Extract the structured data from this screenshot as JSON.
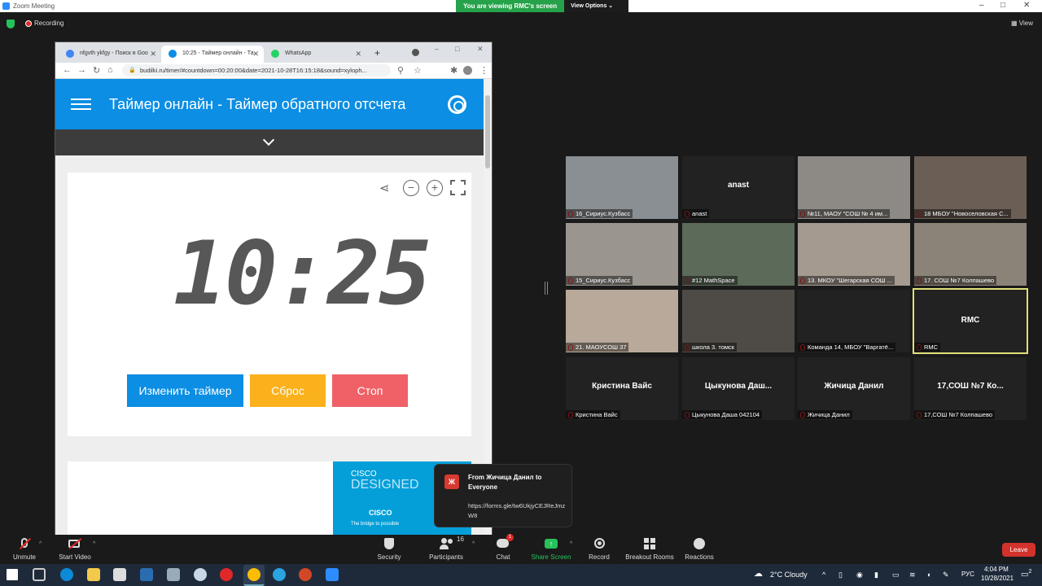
{
  "window": {
    "title": "Zoom Meeting",
    "controls": [
      "–",
      "□",
      "✕"
    ]
  },
  "banner": {
    "viewing": "You are viewing RMC's screen",
    "view_options": "View Options ⌄"
  },
  "status": {
    "recording": "Recording",
    "view": "View"
  },
  "browser": {
    "tabs": [
      {
        "title": "nfgvth ykfgy - Поиск в Goo",
        "close": "✕"
      },
      {
        "title": "10:25 - Таймер онлайн - Та",
        "close": "✕"
      },
      {
        "title": "WhatsApp",
        "close": "✕"
      }
    ],
    "new_tab": "+",
    "url": "budilki.ru/timer/#countdown=00:20:00&date=2021-10-28T16:15:18&sound=xyloph...",
    "page": {
      "title": "Таймер онлайн - Таймер обратного отсчета",
      "clock": "10:25",
      "buttons": {
        "change": "Изменить таймер",
        "reset": "Сброс",
        "stop": "Стоп"
      },
      "ad": {
        "line1": "CISCO",
        "line2": "DESIGNED",
        "line3": "CISCO",
        "line4": "The bridge to possible"
      }
    }
  },
  "toast": {
    "avatar": "Ж",
    "from": "From Жичица Данил to Everyone",
    "message": "https://forms.gle/tw6UkjyCEJReJmzW8"
  },
  "gallery": [
    {
      "name": "16_Сириус.Кузбасс",
      "big": "",
      "color": "#8a8f93"
    },
    {
      "name": "anast",
      "big": "anast",
      "color": "#222222"
    },
    {
      "name": "№11, МАОУ \"СОШ № 4 им...",
      "big": "",
      "color": "#8d8a86"
    },
    {
      "name": "18 МБОУ \"Новоселовская С...",
      "big": "",
      "color": "#6b5e55"
    },
    {
      "name": "15_Сириус.Кузбасс",
      "big": "",
      "color": "#9a958e"
    },
    {
      "name": "#12 MathSpace",
      "big": "",
      "color": "#5c6a5a"
    },
    {
      "name": "13. МКОУ \"Шегарская СОШ ...",
      "big": "",
      "color": "#a59a90"
    },
    {
      "name": "17. СОШ №7 Колпашево",
      "big": "",
      "color": "#8c8378"
    },
    {
      "name": "21. МАОУСОШ 37",
      "big": "",
      "color": "#b8a99a"
    },
    {
      "name": "школа 3. томск",
      "big": "",
      "color": "#4e4b46"
    },
    {
      "name": "Команда 14, МБОУ \"Варгатё...",
      "big": "",
      "color": "#222222"
    },
    {
      "name": "RMC",
      "big": "RMC",
      "color": "#222222"
    },
    {
      "name": "Кристина Вайс",
      "big": "Кристина Вайс",
      "color": "#222222"
    },
    {
      "name": "Цыкунова Даша 042104",
      "big": "Цыкунова  Даш...",
      "color": "#222222"
    },
    {
      "name": "Жичица Данил",
      "big": "Жичица Данил",
      "color": "#222222"
    },
    {
      "name": "17,СОШ №7 Колпашево",
      "big": "17,СОШ №7 Ко...",
      "color": "#222222"
    }
  ],
  "toolbar": {
    "unmute": "Unmute",
    "start_video": "Start Video",
    "security": "Security",
    "participants": "Participants",
    "participants_count": "16",
    "chat": "Chat",
    "chat_badge": "1",
    "share_screen": "Share Screen",
    "record": "Record",
    "breakout": "Breakout Rooms",
    "reactions": "Reactions",
    "leave": "Leave"
  },
  "taskbar": {
    "weather": "2°C  Cloudy",
    "lang": "РУС",
    "time": "4:04 PM",
    "date": "10/28/2021",
    "notif": "2"
  },
  "colors": {
    "zoom_blue": "#2d8cff",
    "green": "#26a24a",
    "leave_red": "#d3322c",
    "site_blue": "#0b8ee3"
  }
}
